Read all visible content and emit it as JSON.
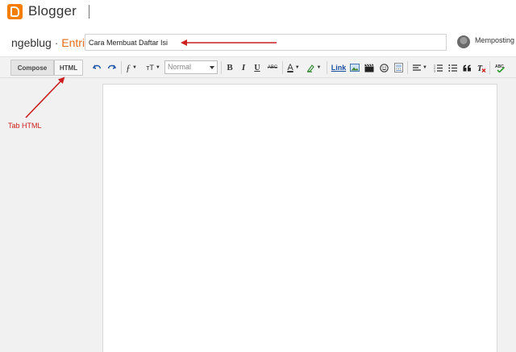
{
  "app": {
    "name": "Blogger"
  },
  "header": {
    "blog_name": "ngeblug",
    "separator": "·",
    "section": "Entri",
    "title_value": "Cara Membuat Daftar Isi",
    "status": "Memposting"
  },
  "toolbar": {
    "compose_label": "Compose",
    "html_label": "HTML",
    "format_select": "Normal",
    "link_label": "Link",
    "font_icon": "ƒ",
    "size_icon": "тT",
    "bold": "B",
    "italic": "I",
    "underline": "U",
    "strike": "ABC",
    "text_color": "A"
  },
  "annotation": {
    "tab_label": "Tab HTML",
    "color": "#cc1f1f"
  },
  "colors": {
    "brand": "#f57d00",
    "section": "#e66c17"
  }
}
